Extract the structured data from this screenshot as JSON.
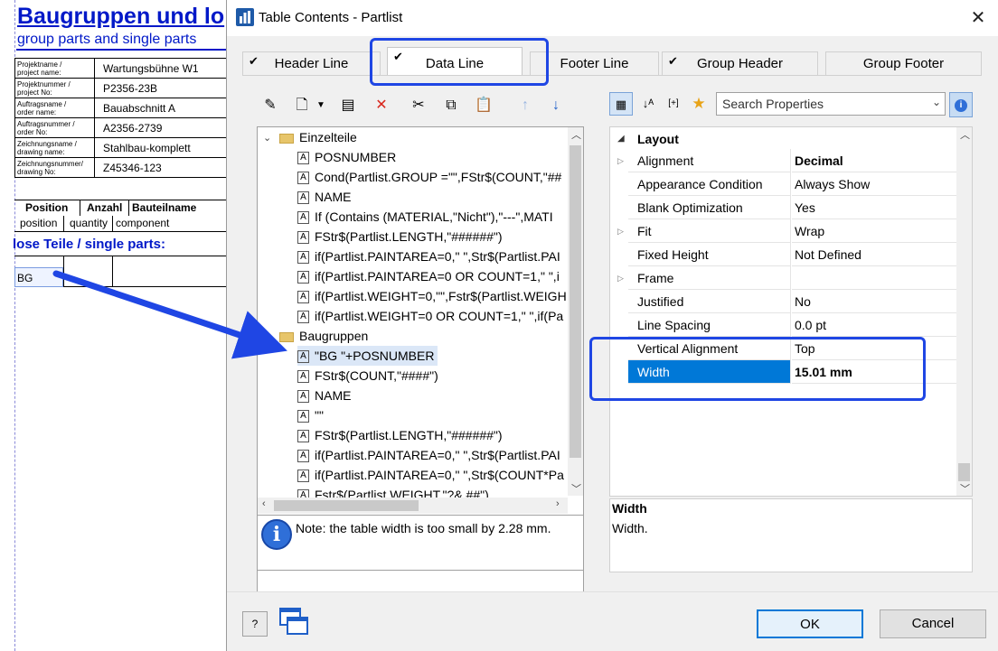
{
  "report": {
    "title": "Baugruppen und lo",
    "subtitle": "group parts and single parts",
    "meta": [
      {
        "label1": "Projektname /",
        "label2": "project name:",
        "value": "Wartungsbühne W1"
      },
      {
        "label1": "Projektnummer /",
        "label2": "project No:",
        "value": "P2356-23B"
      },
      {
        "label1": "Auftragsname /",
        "label2": "order name:",
        "value": "Bauabschnitt A"
      },
      {
        "label1": "Auftragsnummer /",
        "label2": "order No:",
        "value": "A2356-2739"
      },
      {
        "label1": "Zeichnungsname /",
        "label2": "drawing name:",
        "value": "Stahlbau-komplett"
      },
      {
        "label1": "Zeichnungsnummer/",
        "label2": "drawing No:",
        "value": "Z45346-123"
      }
    ],
    "columns_de": [
      "Position",
      "Anzahl",
      "Bauteilname"
    ],
    "columns_en": [
      "position",
      "quantity",
      "component"
    ],
    "section": "lose Teile / single parts:",
    "bg_cell": "BG"
  },
  "dialog": {
    "title": "Table Contents - Partlist",
    "close": "✕",
    "tabs": [
      {
        "label": "Header Line",
        "check": "✔"
      },
      {
        "label": "Data Line",
        "check": "✔"
      },
      {
        "label": "Footer Line",
        "check": ""
      },
      {
        "label": "Group Header",
        "check": "✔"
      },
      {
        "label": "Group Footer",
        "check": ""
      }
    ]
  },
  "tree": {
    "groups": [
      {
        "label": "Einzelteile",
        "items": [
          "POSNUMBER",
          "Cond(Partlist.GROUP =\"\",FStr$(COUNT,\"##",
          "NAME",
          "If (Contains (MATERIAL,\"Nicht\"),\"---\",MATI",
          "FStr$(Partlist.LENGTH,\"######\")",
          "if(Partlist.PAINTAREA=0,\" \",Str$(Partlist.PAI",
          "if(Partlist.PAINTAREA=0 OR COUNT=1,\" \",i",
          "if(Partlist.WEIGHT=0,\"\",Fstr$(Partlist.WEIGH",
          "if(Partlist.WEIGHT=0 OR COUNT=1,\" \",if(Pa"
        ]
      },
      {
        "label": "Baugruppen",
        "items": [
          "\"BG \"+POSNUMBER",
          "FStr$(COUNT,\"####\")",
          "NAME",
          "\"\"",
          "FStr$(Partlist.LENGTH,\"######\")",
          "if(Partlist.PAINTAREA=0,\" \",Str$(Partlist.PAI",
          "if(Partlist.PAINTAREA=0,\" \",Str$(COUNT*Pa",
          "Fstr$(Partlist.WEIGHT,\"?&.##\")"
        ]
      }
    ],
    "note": "Note: the table width is too small by 2.28 mm."
  },
  "properties": {
    "search_placeholder": "Search Properties",
    "category": "Layout",
    "rows": [
      {
        "name": "Alignment",
        "value": "Decimal",
        "expandable": true,
        "bold": true
      },
      {
        "name": "Appearance Condition",
        "value": "Always Show",
        "expandable": false,
        "bold": false
      },
      {
        "name": "Blank Optimization",
        "value": "Yes",
        "expandable": false,
        "bold": false
      },
      {
        "name": "Fit",
        "value": "Wrap",
        "expandable": true,
        "bold": false
      },
      {
        "name": "Fixed Height",
        "value": "Not Defined",
        "expandable": false,
        "bold": false
      },
      {
        "name": "Frame",
        "value": "",
        "expandable": true,
        "bold": false
      },
      {
        "name": "Justified",
        "value": "No",
        "expandable": false,
        "bold": false
      },
      {
        "name": "Line Spacing",
        "value": "0.0 pt",
        "expandable": false,
        "bold": false
      },
      {
        "name": "Vertical Alignment",
        "value": "Top",
        "expandable": false,
        "bold": false
      },
      {
        "name": "Width",
        "value": "15.01 mm",
        "expandable": false,
        "bold": true
      }
    ],
    "selected_index": 9,
    "desc_title": "Width",
    "desc_text": "Width."
  },
  "buttons": {
    "ok": "OK",
    "cancel": "Cancel",
    "help": "?"
  },
  "colors": {
    "accent": "#1f46e4",
    "selection": "#0078d7",
    "report_blue": "#0018c8"
  }
}
